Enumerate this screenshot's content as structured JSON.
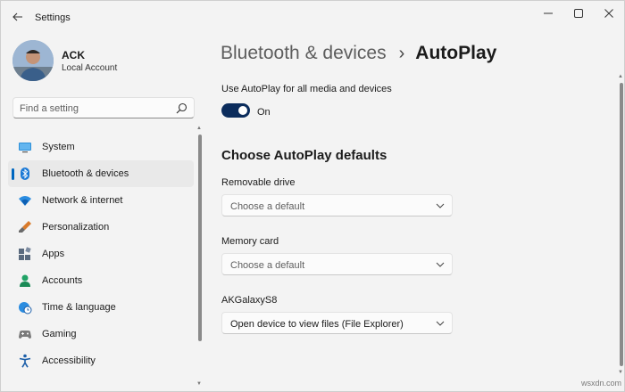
{
  "window": {
    "title": "Settings",
    "controls": [
      "minimize-icon",
      "maximize-icon",
      "close-icon"
    ]
  },
  "user": {
    "name": "ACK",
    "account_type": "Local Account"
  },
  "search": {
    "placeholder": "Find a setting",
    "value": ""
  },
  "sidebar": {
    "items": [
      {
        "label": "System",
        "icon": "monitor-icon",
        "active": false
      },
      {
        "label": "Bluetooth & devices",
        "icon": "bluetooth-icon",
        "active": true
      },
      {
        "label": "Network & internet",
        "icon": "wifi-icon",
        "active": false
      },
      {
        "label": "Personalization",
        "icon": "brush-icon",
        "active": false
      },
      {
        "label": "Apps",
        "icon": "apps-icon",
        "active": false
      },
      {
        "label": "Accounts",
        "icon": "person-icon",
        "active": false
      },
      {
        "label": "Time & language",
        "icon": "globe-clock-icon",
        "active": false
      },
      {
        "label": "Gaming",
        "icon": "gamepad-icon",
        "active": false
      },
      {
        "label": "Accessibility",
        "icon": "accessibility-icon",
        "active": false
      }
    ]
  },
  "breadcrumb": {
    "parent": "Bluetooth & devices",
    "separator": "›",
    "current": "AutoPlay"
  },
  "autoplay": {
    "toggle_label": "Use AutoPlay for all media and devices",
    "toggle_state": "On",
    "toggle_on": true
  },
  "defaults": {
    "section_title": "Choose AutoPlay defaults",
    "fields": [
      {
        "label": "Removable drive",
        "value": "Choose a default"
      },
      {
        "label": "Memory card",
        "value": "Choose a default"
      },
      {
        "label": "AKGalaxyS8",
        "value": "Open device to view files (File Explorer)"
      }
    ]
  },
  "watermark": "wsxdn.com",
  "colors": {
    "accent": "#0067c0",
    "toggle_on": "#0b2c5c",
    "background": "#f3f3f3"
  }
}
